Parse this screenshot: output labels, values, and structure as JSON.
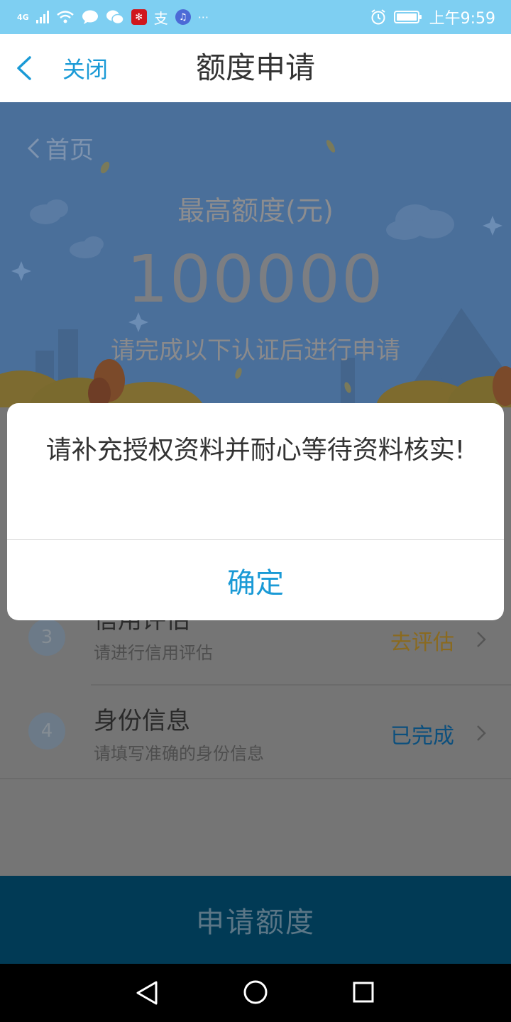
{
  "status_bar": {
    "network_label": "4G",
    "alipay_glyph": "支",
    "more_glyph": "···",
    "time": "上午9:59",
    "icons": [
      "signal-icon",
      "wifi-icon",
      "message-icon",
      "wechat-icon",
      "app-icon",
      "alipay-icon",
      "music-icon",
      "alarm-icon",
      "battery-icon"
    ]
  },
  "nav": {
    "close_label": "关闭",
    "title": "额度申请"
  },
  "hero": {
    "back_label": "首页",
    "limit_label": "最高额度(元)",
    "limit_amount": "100000",
    "instruction": "请完成以下认证后进行申请"
  },
  "steps": [
    {
      "number": "3",
      "title": "信用评估",
      "subtitle": "请进行信用评估",
      "action": "去评估",
      "action_color": "#8a6a1f"
    },
    {
      "number": "4",
      "title": "身份信息",
      "subtitle": "请填写准确的身份信息",
      "action": "已完成",
      "action_color": "#0c4f7d"
    }
  ],
  "apply_button": "申请额度",
  "dialog": {
    "message": "请补充授权资料并耐心等待资料核实!",
    "confirm_label": "确定"
  },
  "colors": {
    "accent": "#1a9ad6",
    "status_bar": "#7ecff2",
    "overlay_hero": "#4a6f9a"
  }
}
